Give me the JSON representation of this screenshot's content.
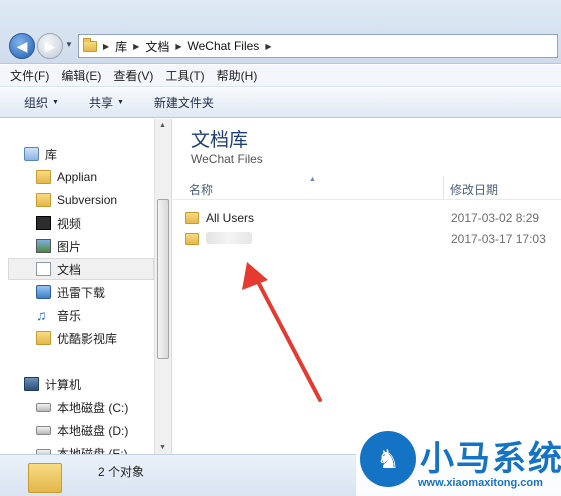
{
  "address_bar": {
    "crumbs": [
      "库",
      "文档",
      "WeChat Files"
    ]
  },
  "menu": {
    "items": [
      "文件(F)",
      "编辑(E)",
      "查看(V)",
      "工具(T)",
      "帮助(H)"
    ]
  },
  "toolbar": {
    "organize": "组织",
    "share": "共享",
    "new_folder": "新建文件夹"
  },
  "nav": {
    "libraries_label": "库",
    "items": [
      "Applian",
      "Subversion",
      "视频",
      "图片",
      "文档",
      "迅雷下载",
      "音乐",
      "优酷影视库"
    ],
    "computer_label": "计算机",
    "drives": [
      "本地磁盘 (C:)",
      "本地磁盘 (D:)",
      "本地磁盘 (E:)"
    ]
  },
  "content": {
    "library_title": "文档库",
    "library_subtitle": "WeChat Files",
    "col_name": "名称",
    "col_date": "修改日期",
    "files": [
      {
        "name": "All Users",
        "date": "2017-03-02 8:29"
      },
      {
        "name": "",
        "date": "2017-03-17 17:03"
      }
    ]
  },
  "status": {
    "count_text": "2 个对象"
  },
  "watermark": {
    "title": "小马系统",
    "url": "www.xiaomaxitong.com"
  },
  "colors": {
    "accent": "#1573c5",
    "arrow": "#e53a2f"
  }
}
